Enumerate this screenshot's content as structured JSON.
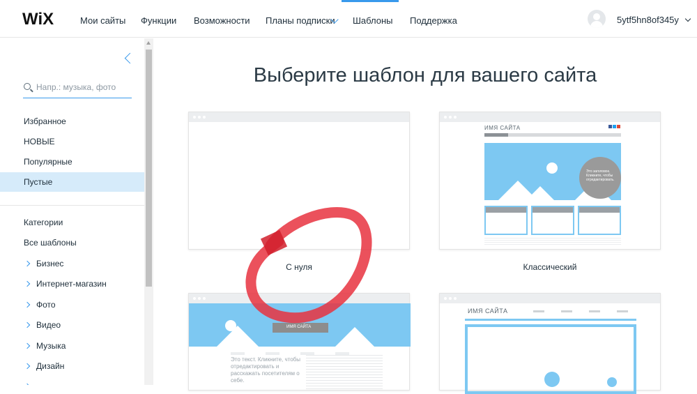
{
  "app": {
    "logo": "WiX",
    "nav": [
      "Мои сайты",
      "Функции",
      "Возможности",
      "Планы подписки",
      "Шаблоны",
      "Поддержка"
    ],
    "user": "5ytf5hn8of345y",
    "accent": "#3899ec"
  },
  "sidebar": {
    "search_placeholder": "Напр.: музыка, фото",
    "filters": [
      {
        "label": "Избранное",
        "active": false
      },
      {
        "label": "НОВЫЕ",
        "active": false
      },
      {
        "label": "Популярные",
        "active": false
      },
      {
        "label": "Пустые",
        "active": true
      }
    ],
    "categories_title": "Категории",
    "all_templates": "Все шаблоны",
    "categories": [
      "Бизнес",
      "Интернет-магазин",
      "Фото",
      "Видео",
      "Музыка",
      "Дизайн"
    ]
  },
  "main": {
    "title": "Выберите шаблон для вашего сайта",
    "templates": [
      {
        "label": "С нуля"
      },
      {
        "label": "Классический",
        "site_name": "ИМЯ САЙТА",
        "bubble": "Это заголовок. Кликните, чтобы отредактировать."
      },
      {
        "label": "",
        "site_name": "ИМЯ САЙТА",
        "text": "Это текст. Кликните, чтобы отредактировать и расскажать посетителям о себе."
      },
      {
        "label": "",
        "site_name": "ИМЯ САЙТА"
      }
    ]
  },
  "annotation_color": "#e8323f"
}
